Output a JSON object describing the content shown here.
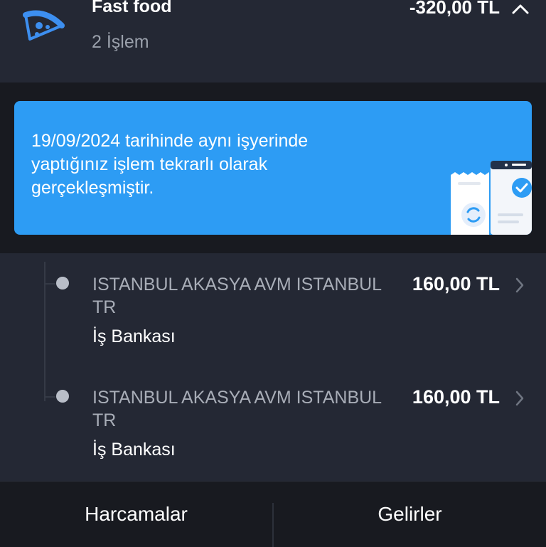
{
  "category": {
    "icon": "pizza-icon",
    "title": "Fast food",
    "count": "2 İşlem",
    "total": "-320,00 TL",
    "expand_icon": "chevron-up-icon"
  },
  "banner": {
    "message": "19/09/2024 tarihinde aynı işyerinde yaptığınız işlem tekrarlı olarak gerçekleşmiştir.",
    "illustration": "receipt-check-icon",
    "color": "#2d9cf4"
  },
  "transactions": [
    {
      "merchant": "ISTANBUL AKASYA AVM ISTANBUL TR",
      "bank": "İş Bankası",
      "amount": "160,00 TL",
      "icon": "chevron-right-icon"
    },
    {
      "merchant": "ISTANBUL AKASYA AVM ISTANBUL TR",
      "bank": "İş Bankası",
      "amount": "160,00 TL",
      "icon": "chevron-right-icon"
    }
  ],
  "tabs": {
    "expenses": "Harcamalar",
    "income": "Gelirler"
  },
  "colors": {
    "background": "#181a20",
    "panel": "#242834",
    "accent": "#2d9cf4",
    "muted_text": "#9aa0ab"
  }
}
